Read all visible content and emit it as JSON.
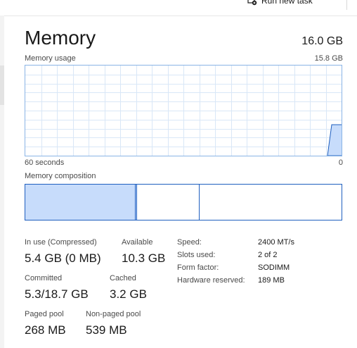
{
  "toolbar": {
    "run_new_task": "Run new task"
  },
  "header": {
    "title": "Memory",
    "total": "16.0 GB"
  },
  "graph": {
    "label": "Memory usage",
    "max_label": "15.8 GB",
    "time_left": "60 seconds",
    "time_right": "0",
    "fill_color": "#c7dcfb",
    "line_color": "#1f5fbf",
    "grid_color": "#d9e7f7"
  },
  "composition": {
    "label": "Memory composition"
  },
  "stats": {
    "in_use": {
      "label": "In use (Compressed)",
      "value": "5.4 GB (0 MB)"
    },
    "available": {
      "label": "Available",
      "value": "10.3 GB"
    },
    "committed": {
      "label": "Committed",
      "value": "5.3/18.7 GB"
    },
    "cached": {
      "label": "Cached",
      "value": "3.2 GB"
    },
    "paged_pool": {
      "label": "Paged pool",
      "value": "268 MB"
    },
    "non_paged_pool": {
      "label": "Non-paged pool",
      "value": "539 MB"
    }
  },
  "details": [
    {
      "label": "Speed:",
      "value": "2400 MT/s"
    },
    {
      "label": "Slots used:",
      "value": "2 of 2"
    },
    {
      "label": "Form factor:",
      "value": "SODIMM"
    },
    {
      "label": "Hardware reserved:",
      "value": "189 MB"
    }
  ]
}
